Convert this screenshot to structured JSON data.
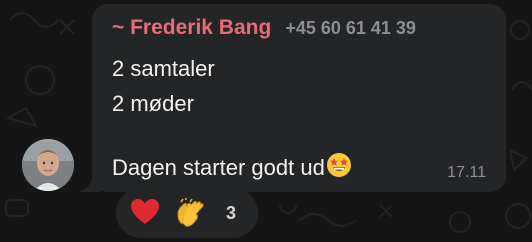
{
  "message": {
    "sender_name": "~ Frederik Bang",
    "sender_phone": "+45 60 61 41 39",
    "lines": [
      "2 samtaler",
      "2 møder",
      "",
      "Dagen starter godt ud"
    ],
    "inline_emoji": "star-struck-emoji",
    "timestamp": "17.11"
  },
  "reactions": {
    "items": [
      {
        "emoji": "red-heart-emoji"
      },
      {
        "emoji": "clapping-hands-emoji"
      }
    ],
    "count": "3"
  },
  "colors": {
    "background": "#151515",
    "bubble": "#242526",
    "sender_name": "#e96c7a",
    "secondary_text": "#8d8e91",
    "message_text": "#f2f2f2"
  }
}
